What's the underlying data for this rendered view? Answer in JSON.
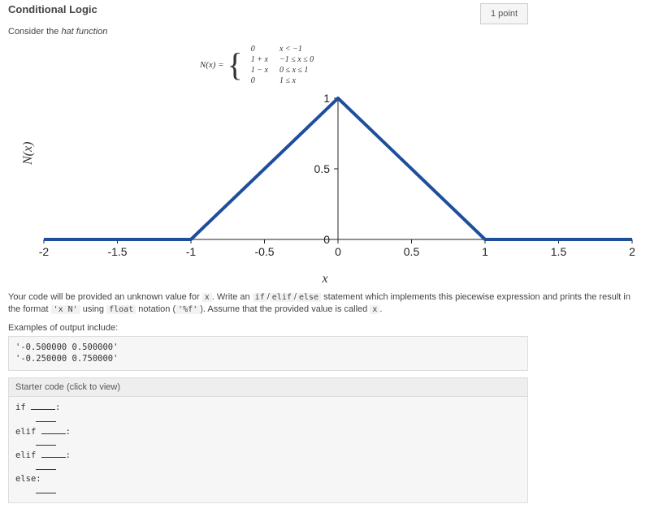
{
  "header": {
    "title": "Conditional Logic",
    "points": "1 point"
  },
  "intro": {
    "prefix": "Consider the ",
    "italic": "hat function"
  },
  "formula": {
    "label": "N(x) =",
    "rows": [
      {
        "val": "0",
        "cond": "x < −1"
      },
      {
        "val": "1 + x",
        "cond": "−1 ≤ x ≤ 0"
      },
      {
        "val": "1 − x",
        "cond": "0 ≤ x ≤ 1"
      },
      {
        "val": "0",
        "cond": "1 ≤ x"
      }
    ]
  },
  "chart_data": {
    "type": "line",
    "xlabel": "x",
    "ylabel": "N(x)",
    "xlim": [
      -2,
      2
    ],
    "ylim": [
      0,
      1
    ],
    "xticks": [
      -2,
      -1.5,
      -1,
      -0.5,
      0,
      0.5,
      1,
      1.5,
      2
    ],
    "yticks": [
      0,
      0.5,
      1
    ],
    "series": [
      {
        "name": "N(x)",
        "x": [
          -2,
          -1,
          0,
          1,
          2
        ],
        "y": [
          0,
          0,
          1,
          0,
          0
        ]
      }
    ]
  },
  "question": {
    "p1a": "Your code will be provided an unknown value for ",
    "c1": "x",
    "p1b": ". Write an ",
    "c2": "if",
    "p1c": "/",
    "c3": "elif",
    "p1d": "/",
    "c4": "else",
    "p1e": " statement which implements this piecewise expression and prints the result in the format ",
    "c5": "'x N'",
    "p1f": " using ",
    "c6": "float",
    "p1g": " notation (",
    "c7": "'%f'",
    "p1h": "). Assume that the provided value is called ",
    "c8": "x",
    "p1i": "."
  },
  "examples": {
    "heading": "Examples of output include:",
    "code": "'-0.500000 0.500000'\n'-0.250000 0.750000'"
  },
  "starter": {
    "header": "Starter code (click to view)",
    "if": "if ",
    "colon": ":",
    "elif": "elif ",
    "else": "else:"
  }
}
